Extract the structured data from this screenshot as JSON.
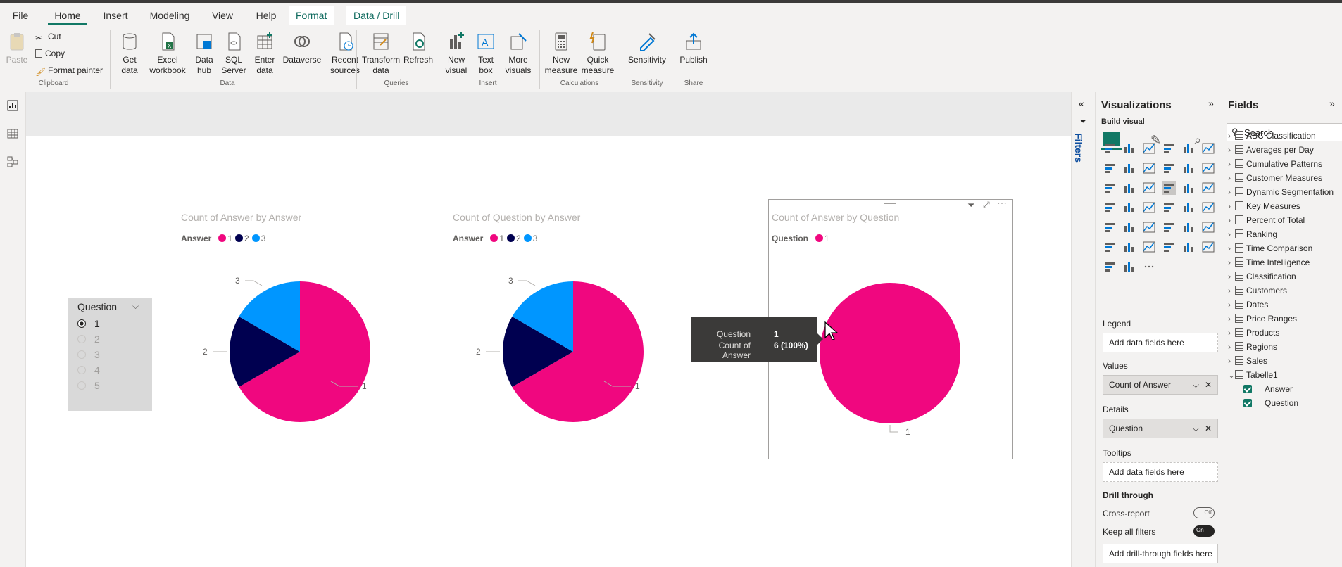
{
  "tabs": [
    "File",
    "Home",
    "Insert",
    "Modeling",
    "View",
    "Help",
    "Format",
    "Data / Drill"
  ],
  "clipboard": {
    "paste": "Paste",
    "cut": "Cut",
    "copy": "Copy",
    "format_painter": "Format painter",
    "label": "Clipboard"
  },
  "data_group": {
    "get_data": "Get data",
    "excel": "Excel workbook",
    "data_hub": "Data hub",
    "sql": "SQL Server",
    "enter": "Enter data",
    "dataverse": "Dataverse",
    "recent": "Recent sources",
    "label": "Data"
  },
  "queries": {
    "transform": "Transform data",
    "refresh": "Refresh",
    "label": "Queries"
  },
  "insert": {
    "new_visual": "New visual",
    "text_box": "Text box",
    "more": "More visuals",
    "label": "Insert"
  },
  "calcs": {
    "new_measure": "New measure",
    "quick": "Quick measure",
    "label": "Calculations"
  },
  "sens": {
    "btn": "Sensitivity",
    "label": "Sensitivity"
  },
  "share": {
    "publish": "Publish",
    "label": "Share"
  },
  "slicer": {
    "title": "Question",
    "options": [
      "1",
      "2",
      "3",
      "4",
      "5"
    ],
    "selected": "1"
  },
  "visual1": {
    "title": "Count of Answer by Answer",
    "legend_title": "Answer",
    "legend": [
      "1",
      "2",
      "3"
    ],
    "labels": [
      "1",
      "2",
      "3"
    ]
  },
  "visual2": {
    "title": "Count of Question by Answer",
    "legend_title": "Answer",
    "legend": [
      "1",
      "2",
      "3"
    ],
    "labels": [
      "1",
      "2",
      "3"
    ]
  },
  "visual3": {
    "title": "Count of Answer by Question",
    "legend_title": "Question",
    "legend": [
      "1"
    ],
    "labels": [
      "1"
    ]
  },
  "chart_data": [
    {
      "type": "pie",
      "title": "Count of Answer by Answer",
      "categories": [
        "1",
        "2",
        "3"
      ],
      "values": [
        4,
        1,
        1
      ]
    },
    {
      "type": "pie",
      "title": "Count of Question by Answer",
      "categories": [
        "1",
        "2",
        "3"
      ],
      "values": [
        4,
        1,
        1
      ]
    },
    {
      "type": "pie",
      "title": "Count of Answer by Question",
      "categories": [
        "1"
      ],
      "values": [
        6
      ]
    }
  ],
  "colors": {
    "c1": "#f0077f",
    "c2": "#000050",
    "c3": "#0096ff",
    "accent": "#117865"
  },
  "tooltip": {
    "k1": "Question",
    "v1": "1",
    "k2": "Count of Answer",
    "v2": "6 (100%)"
  },
  "filters_label": "Filters",
  "viz": {
    "title": "Visualizations",
    "build": "Build visual",
    "legend": "Legend",
    "legend_ph": "Add data fields here",
    "values": "Values",
    "values_field": "Count of Answer",
    "details": "Details",
    "details_field": "Question",
    "tooltips": "Tooltips",
    "tooltips_ph": "Add data fields here",
    "drill": "Drill through",
    "cross": "Cross-report",
    "cross_state": "Off",
    "keep": "Keep all filters",
    "keep_state": "On",
    "drill_ph": "Add drill-through fields here"
  },
  "fields": {
    "title": "Fields",
    "search_ph": "Search",
    "items": [
      "ABC Classification",
      "Averages per Day",
      "Cumulative Patterns",
      "Customer Measures",
      "Dynamic Segmentation",
      "Key Measures",
      "Percent of Total",
      "Ranking",
      "Time Comparison",
      "Time Intelligence",
      "Classification",
      "Customers",
      "Dates",
      "Price Ranges",
      "Products",
      "Regions",
      "Sales",
      "Tabelle1"
    ],
    "sub": [
      "Answer",
      "Question"
    ]
  }
}
